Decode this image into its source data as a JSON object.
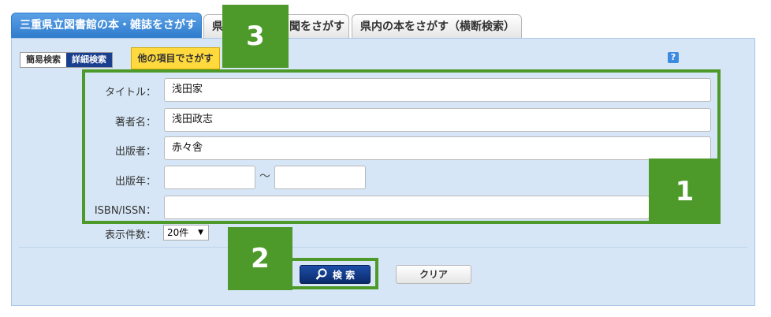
{
  "tabs": [
    {
      "label": "三重県立図書館の本・雑誌をさがす",
      "active": true
    },
    {
      "label": "県　　　　　　聞をさがす",
      "active": false
    },
    {
      "label": "県内の本をさがす（横断検索）",
      "active": false
    }
  ],
  "mode_switch": {
    "simple": "簡易検索",
    "detail": "詳細検索"
  },
  "other_items_tab": "他の項目でさがす",
  "help_icon": "?",
  "form": {
    "title_label": "タイトル：",
    "title_value": "浅田家",
    "author_label": "著者名：",
    "author_value": "浅田政志",
    "publisher_label": "出版者：",
    "publisher_value": "赤々舎",
    "year_label": "出版年：",
    "year_from": "",
    "year_sep": "～",
    "year_to": "",
    "isbn_label": "ISBN/ISSN：",
    "isbn_value": "",
    "count_label": "表示件数：",
    "count_value": "20件"
  },
  "buttons": {
    "search": "検 索",
    "clear": "クリア"
  },
  "callouts": {
    "one": "1",
    "two": "2",
    "three": "3"
  },
  "colors": {
    "accent_green": "#4d9a2a",
    "tab_blue": "#2f7ccd",
    "highlight_yellow": "#ffd93d",
    "panel_bg": "#d6e6f6"
  }
}
